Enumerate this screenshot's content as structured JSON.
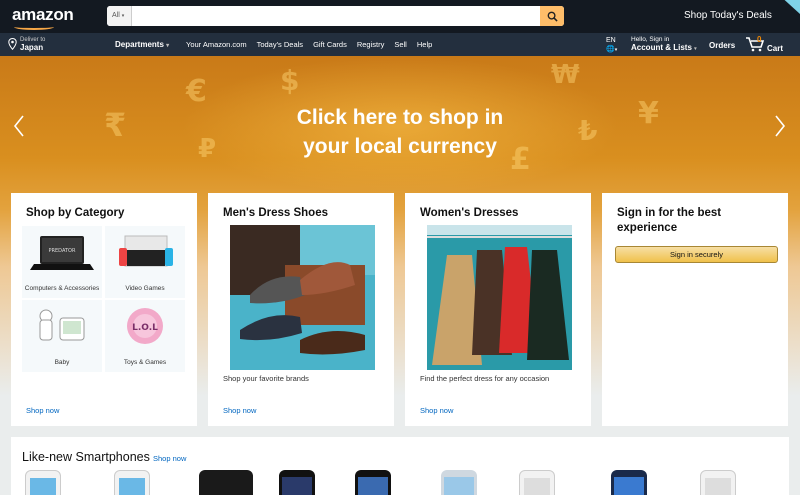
{
  "header": {
    "logo": "amazon",
    "search": {
      "category": "All",
      "placeholder": ""
    },
    "promo": "Shop Today's Deals"
  },
  "subnav": {
    "deliver_to": "Deliver to",
    "deliver_country": "Japan",
    "departments": "Departments",
    "links": [
      "Your Amazon.com",
      "Today's Deals",
      "Gift Cards",
      "Registry",
      "Sell",
      "Help"
    ],
    "language": "EN",
    "account_greeting": "Hello, Sign in",
    "account_label": "Account & Lists",
    "orders": "Orders",
    "cart_count": "0",
    "cart_label": "Cart"
  },
  "hero": {
    "line1": "Click here to shop in",
    "line2": "your local currency"
  },
  "cards": {
    "category": {
      "title": "Shop by Category",
      "tiles": [
        "Computers & Accessories",
        "Video Games",
        "Baby",
        "Toys & Games"
      ],
      "link": "Shop now"
    },
    "shoes": {
      "title": "Men's Dress Shoes",
      "caption": "Shop your favorite brands",
      "link": "Shop now"
    },
    "dresses": {
      "title": "Women's Dresses",
      "caption": "Find the perfect dress for any occasion",
      "link": "Shop now"
    },
    "signin": {
      "title_line1": "Sign in for the best",
      "title_line2": "experience",
      "button": "Sign in securely"
    }
  },
  "smartphones": {
    "title": "Like-new Smartphones",
    "link": "Shop now"
  },
  "colors": {
    "nav": "#131921",
    "subnav": "#232f3e",
    "accent": "#febd69",
    "link": "#0066c0"
  }
}
